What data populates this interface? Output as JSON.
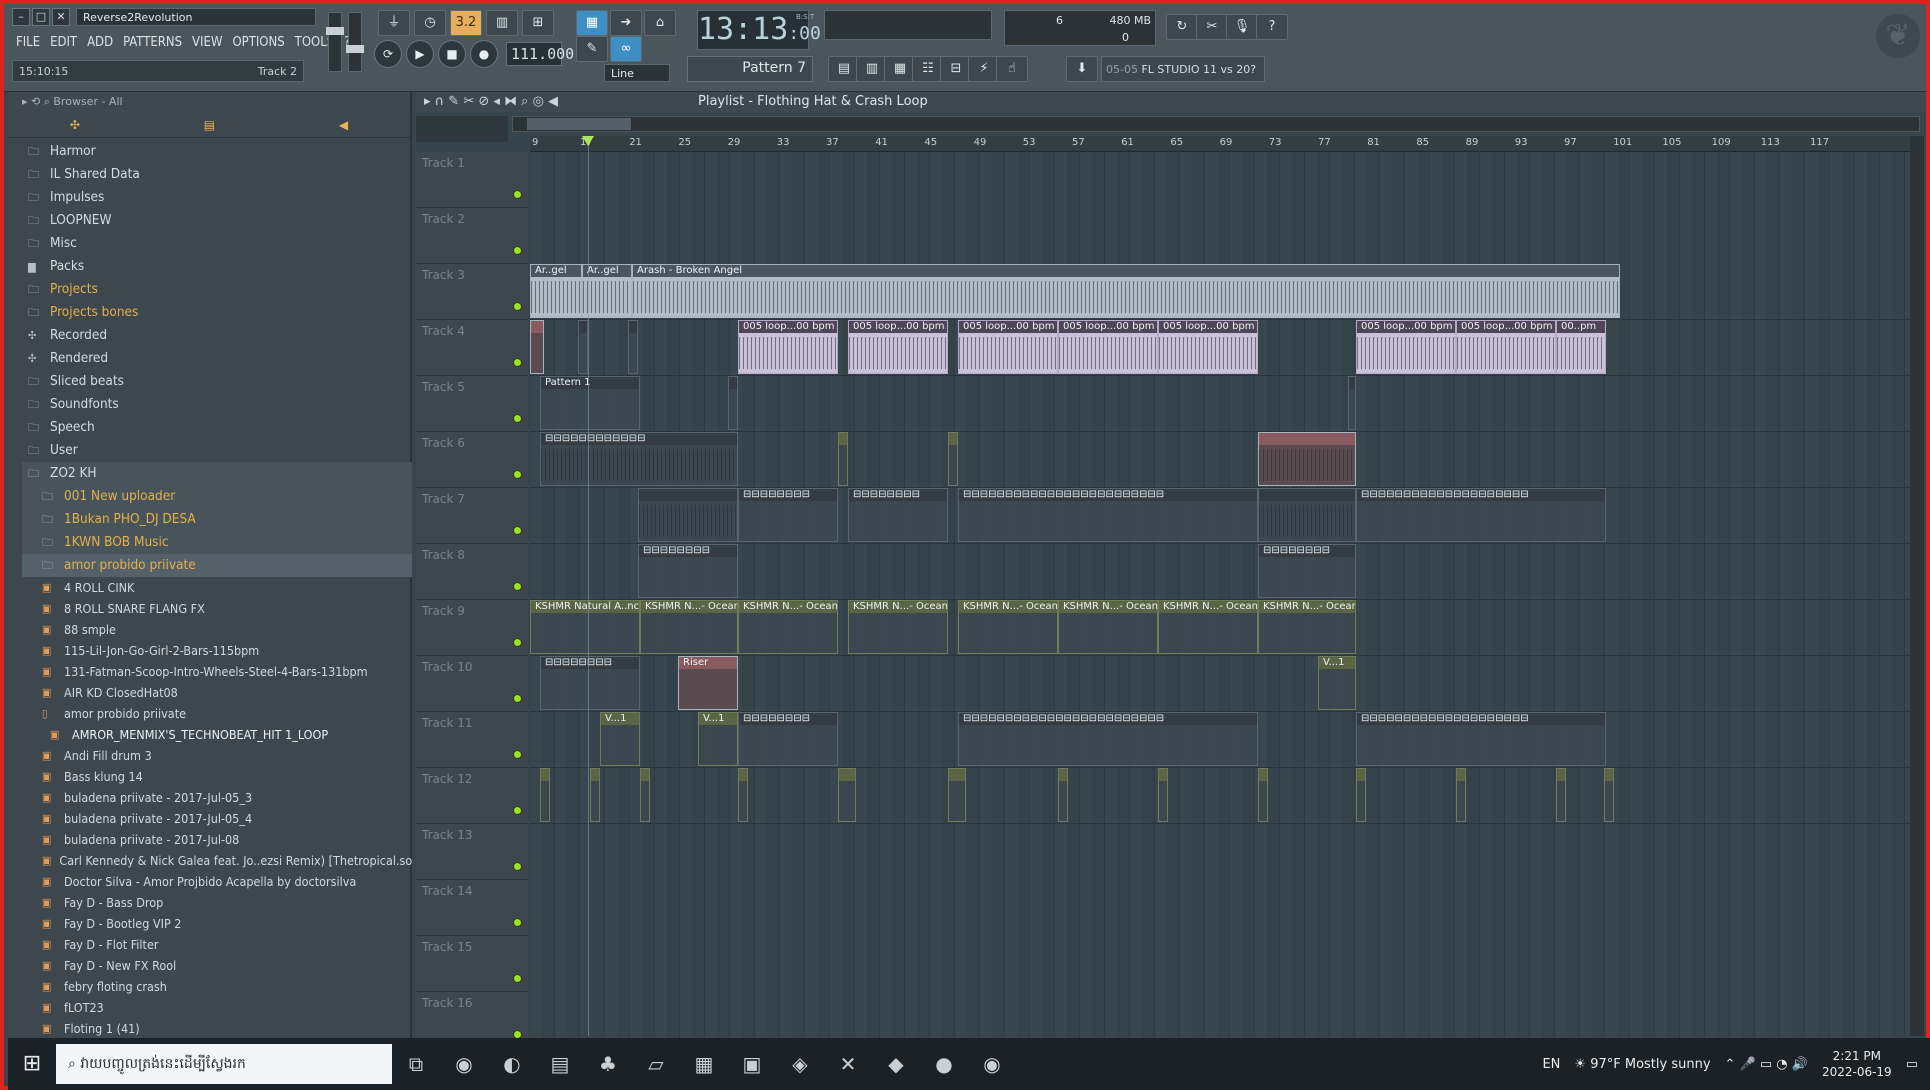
{
  "window": {
    "title": "Reverse2Revolution"
  },
  "menu": [
    "FILE",
    "EDIT",
    "ADD",
    "PATTERNS",
    "VIEW",
    "OPTIONS",
    "TOOLS",
    "?"
  ],
  "hint": {
    "time": "15:10:15",
    "track": "Track 2"
  },
  "transport": {
    "tempo": "111.000",
    "time_main": "13:13",
    "time_sub": ":00",
    "time_mode": "B:S:T",
    "snap": "Line",
    "pattern": "Pattern 7"
  },
  "meters": {
    "cpu": "6",
    "mem": "480 MB",
    "poly": "0"
  },
  "news": {
    "date": "05-05",
    "text": "FL STUDIO 11 vs 20?"
  },
  "browser": {
    "title": "Browser - All",
    "folders": [
      "Harmor",
      "IL Shared Data",
      "Impulses",
      "LOOPNEW",
      "Misc",
      "Packs",
      "Projects",
      "Projects bones",
      "Recorded",
      "Rendered",
      "Sliced beats",
      "Soundfonts",
      "Speech",
      "User",
      "ZO2 KH"
    ],
    "subfolders": [
      "001 New uploader",
      "1Bukan PHO_DJ DESA",
      "1KWN BOB Music",
      "amor probido priivate"
    ],
    "files": [
      "4 ROLL CINK",
      "8 ROLL SNARE FLANG FX",
      "88 smple",
      "115-Lil-Jon-Go-Girl-2-Bars-115bpm",
      "131-Fatman-Scoop-Intro-Wheels-Steel-4-Bars-131bpm",
      "AIR KD ClosedHat08",
      "amor probido priivate",
      "AMROR_MENMIX'S_TECHNOBEAT_HIT 1_LOOP",
      "Andi Fill drum 3",
      "Bass  klung 14",
      "buladena priivate - 2017-Jul-05_3",
      "buladena priivate - 2017-Jul-05_4",
      "buladena priivate - 2017-Jul-08",
      "Carl Kennedy & Nick Galea feat. Jo..ezsi Remix) [Thetropical.soda.net]",
      "Doctor Silva - Amor Projbido Acapella by doctorsilva",
      "Fay D - Bass Drop",
      "Fay D - Bootleg VIP 2",
      "Fay D - Flot Filter",
      "Fay D - New FX Rool",
      "febry floting crash",
      "fLOT23",
      "Floting 1  (41)"
    ]
  },
  "playlist": {
    "title": "Playlist - Flothing Hat & Crash Loop",
    "ruler": [
      "9",
      "17",
      "21",
      "25",
      "29",
      "33",
      "37",
      "41",
      "45",
      "49",
      "53",
      "57",
      "61",
      "65",
      "69",
      "73",
      "77",
      "81",
      "85",
      "89",
      "93",
      "97",
      "101",
      "105",
      "109",
      "113",
      "117"
    ],
    "tracks": [
      "Track 1",
      "Track 2",
      "Track 3",
      "Track 4",
      "Track 5",
      "Track 6",
      "Track 7",
      "Track 8",
      "Track 9",
      "Track 10",
      "Track 11",
      "Track 12",
      "Track 13",
      "Track 14",
      "Track 15",
      "Track 16"
    ],
    "labels": {
      "arash_short": "Ar..gel",
      "arash": "Arash - Broken Angel",
      "loop": "005 loop...00 bpm",
      "loop_short": "00..pm",
      "pattern1": "Pattern 1",
      "kshmr_first": "KSHMR Natural A..nce",
      "kshmr": "KSHMR N...- Ocean",
      "riser": "Riser",
      "v": "V...1"
    }
  },
  "taskbar": {
    "search": "វាយបញ្ចូលត្រង់នេះដើម្បីស្វែងរក",
    "lang": "EN",
    "temp": "97°F",
    "weather": "Mostly sunny",
    "time": "2:21 PM",
    "date": "2022-06-19"
  },
  "colors": {
    "accent": "#e8ad5a",
    "led": "#9fe02c",
    "border": "#e0231c"
  }
}
